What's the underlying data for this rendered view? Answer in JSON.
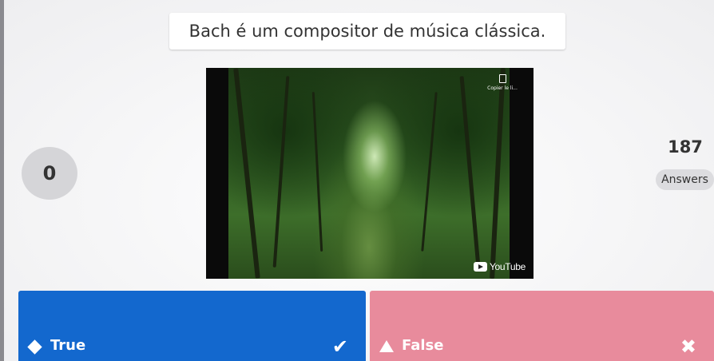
{
  "question": {
    "text": "Bach é um compositor de música clássica."
  },
  "media": {
    "copy_link_label": "Copier le li...",
    "platform_label": "YouTube"
  },
  "timer": {
    "value": "0"
  },
  "answers_counter": {
    "count": "187",
    "label": "Answers"
  },
  "options": [
    {
      "label": "True",
      "shape_icon": "diamond-icon",
      "result_icon": "checkmark-icon",
      "color": "#1368ce",
      "correct": true
    },
    {
      "label": "False",
      "shape_icon": "triangle-icon",
      "result_icon": "cross-icon",
      "color": "#e88b9c",
      "correct": false
    }
  ]
}
